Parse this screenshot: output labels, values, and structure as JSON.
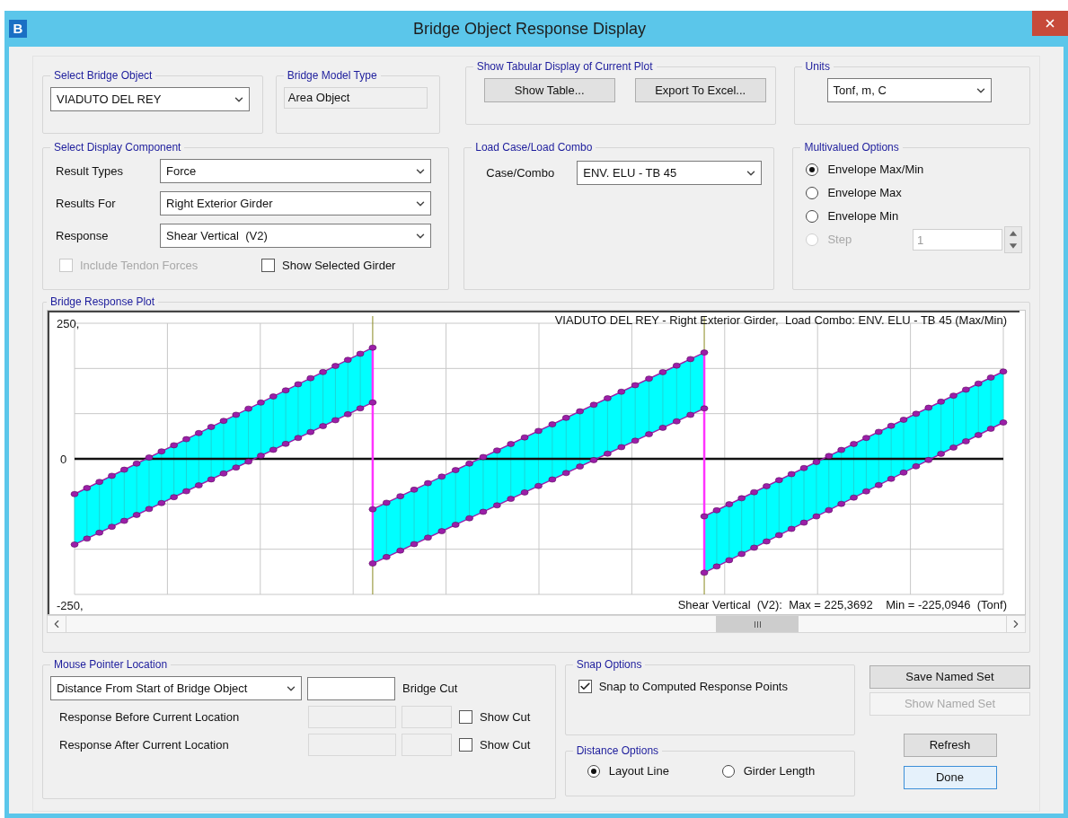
{
  "window": {
    "icon_letter": "B",
    "title": "Bridge Object Response Display"
  },
  "select_bridge_object": {
    "label": "Select Bridge Object",
    "value": "VIADUTO DEL REY"
  },
  "bridge_model_type": {
    "label": "Bridge Model Type",
    "value": "Area Object"
  },
  "tabular_display": {
    "label": "Show Tabular Display of Current Plot",
    "buttons": [
      "Show Table...",
      "Export To Excel..."
    ]
  },
  "units": {
    "label": "Units",
    "value": "Tonf, m, C"
  },
  "display_component": {
    "label": "Select Display Component",
    "fields": [
      {
        "label": "Result Types",
        "value": "Force"
      },
      {
        "label": "Results For",
        "value": "Right Exterior Girder"
      },
      {
        "label": "Response",
        "value": "Shear Vertical  (V2)"
      }
    ],
    "checkboxes": [
      {
        "label": "Include Tendon Forces",
        "checked": false,
        "disabled": true
      },
      {
        "label": "Show Selected Girder",
        "checked": false,
        "disabled": false
      }
    ]
  },
  "load_case": {
    "label": "Load Case/Load Combo",
    "field_label": "Case/Combo",
    "value": "ENV. ELU - TB 45"
  },
  "multivalued_options": {
    "label": "Multivalued Options",
    "options": [
      {
        "label": "Envelope Max/Min",
        "selected": true,
        "disabled": false
      },
      {
        "label": "Envelope Max",
        "selected": false,
        "disabled": false
      },
      {
        "label": "Envelope Min",
        "selected": false,
        "disabled": false
      },
      {
        "label": "Step",
        "selected": false,
        "disabled": true
      }
    ],
    "step_value": "1"
  },
  "plot": {
    "label": "Bridge Response Plot",
    "title": "VIADUTO DEL REY - Right Exterior Girder,  Load Combo: ENV. ELU - TB 45 (Max/Min)",
    "footer": "Shear Vertical  (V2):  Max = 225,3692    Min = -225,0946  (Tonf)",
    "axis_labels": [
      "250,",
      "0",
      "-250,"
    ]
  },
  "mouse_pointer": {
    "label": "Mouse Pointer Location",
    "dropdown": "Distance From Start of Bridge Object",
    "cut_label": "Bridge Cut",
    "rows": [
      {
        "label": "Response Before Current Location",
        "show_cut_label": "Show Cut",
        "checked": false
      },
      {
        "label": "Response After Current Location",
        "show_cut_label": "Show Cut",
        "checked": false
      }
    ]
  },
  "snap_options": {
    "label": "Snap Options",
    "checkbox": {
      "label": "Snap to Computed Response Points",
      "checked": true
    }
  },
  "distance_options": {
    "label": "Distance Options",
    "options": [
      {
        "label": "Layout Line",
        "selected": true
      },
      {
        "label": "Girder Length",
        "selected": false
      }
    ]
  },
  "buttons": [
    {
      "label": "Save Named Set",
      "disabled": false,
      "focused": false
    },
    {
      "label": "Show Named Set",
      "disabled": true,
      "focused": false
    },
    {
      "label": "Refresh",
      "disabled": false,
      "focused": false
    },
    {
      "label": "Done",
      "disabled": false,
      "focused": true
    }
  ]
}
